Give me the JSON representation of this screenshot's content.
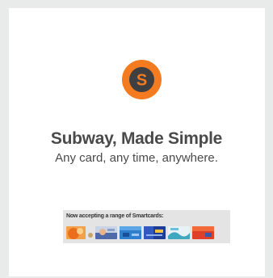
{
  "hero": {
    "logo_letter": "S",
    "logo_colors": {
      "ring": "#f47b20",
      "inner": "#3f3f41",
      "letter": "#f47b20"
    },
    "title": "Subway, Made Simple",
    "subtitle": "Any card, any time, anywhere."
  },
  "smartcards": {
    "label": "Now accepting a range of Smartcards:",
    "cards": [
      {
        "icon": "smartcard-orange-icon",
        "color": "#f08a2a"
      },
      {
        "icon": "smartcard-tap-icon",
        "color": "#5a6fa8"
      },
      {
        "icon": "smartcard-blue-icon",
        "color": "#2a78c8"
      },
      {
        "icon": "smartcard-navy-icon",
        "color": "#1f3f9a"
      },
      {
        "icon": "smartcard-teal-icon",
        "color": "#5ab4c8"
      },
      {
        "icon": "smartcard-red-icon",
        "color": "#e0402a"
      }
    ]
  }
}
